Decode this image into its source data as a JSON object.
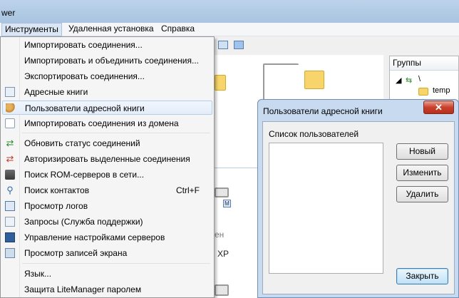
{
  "window": {
    "title_fragment": "wer"
  },
  "menubar": {
    "items": [
      "Инструменты",
      "Удаленная установка",
      "Справка"
    ]
  },
  "tools_menu": {
    "items": [
      {
        "label": "Импортировать соединения...",
        "icon": "none"
      },
      {
        "label": "Импортировать и объединить соединения...",
        "icon": "none"
      },
      {
        "label": "Экспортировать соединения...",
        "icon": "none"
      },
      {
        "label": "Адресные книги",
        "icon": "address-book-icon"
      },
      {
        "label": "Пользователи адресной книги",
        "icon": "users-icon",
        "highlighted": true
      },
      {
        "label": "Импортировать соединения из домена",
        "icon": "domain-import-icon"
      },
      {
        "label": "Обновить статус соединений",
        "icon": "refresh-icon"
      },
      {
        "label": "Авторизировать выделенные соединения",
        "icon": "authorize-icon"
      },
      {
        "label": "Поиск ROM-серверов в сети...",
        "icon": "network-search-icon"
      },
      {
        "label": "Поиск контактов",
        "shortcut": "Ctrl+F",
        "icon": "magnifier-icon"
      },
      {
        "label": "Просмотр логов",
        "icon": "log-icon"
      },
      {
        "label": "Запросы (Служба поддержки)",
        "icon": "envelope-icon"
      },
      {
        "label": "Управление настройками серверов",
        "icon": "monitor-icon"
      },
      {
        "label": "Просмотр записей экрана",
        "icon": "screen-record-icon"
      },
      {
        "label": "Язык...",
        "icon": "none"
      },
      {
        "label": "Защита LiteManager паролем",
        "icon": "none"
      }
    ]
  },
  "groups_panel": {
    "header": "Группы",
    "root": "\\",
    "child": "temp"
  },
  "main_pane": {
    "ghost_texts": [
      "ен",
      "XP"
    ],
    "badge": "M"
  },
  "dialog": {
    "title": "Пользователи адресной книги",
    "close_glyph": "✕",
    "list_label": "Список пользователей",
    "buttons": {
      "new": "Новый",
      "edit": "Изменить",
      "delete": "Удалить",
      "close": "Закрыть"
    }
  }
}
